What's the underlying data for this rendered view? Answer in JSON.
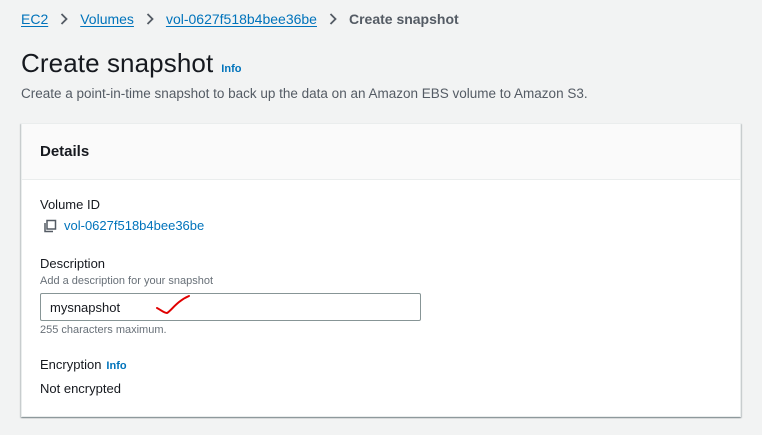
{
  "breadcrumb": {
    "items": [
      "EC2",
      "Volumes",
      "vol-0627f518b4bee36be"
    ],
    "current": "Create snapshot"
  },
  "header": {
    "title": "Create snapshot",
    "info": "Info",
    "description": "Create a point-in-time snapshot to back up the data on an Amazon EBS volume to Amazon S3."
  },
  "details": {
    "title": "Details",
    "volume_id_label": "Volume ID",
    "volume_id_value": "vol-0627f518b4bee36be",
    "description_label": "Description",
    "description_hint": "Add a description for your snapshot",
    "description_value": "mysnapshot",
    "description_constraint": "255 characters maximum.",
    "encryption_label": "Encryption",
    "encryption_info": "Info",
    "encryption_value": "Not encrypted"
  },
  "colors": {
    "link": "#0073bb",
    "annotation_check": "#e00000"
  },
  "icons": {
    "separator": "chevron-right-icon",
    "copy": "copy-icon"
  }
}
